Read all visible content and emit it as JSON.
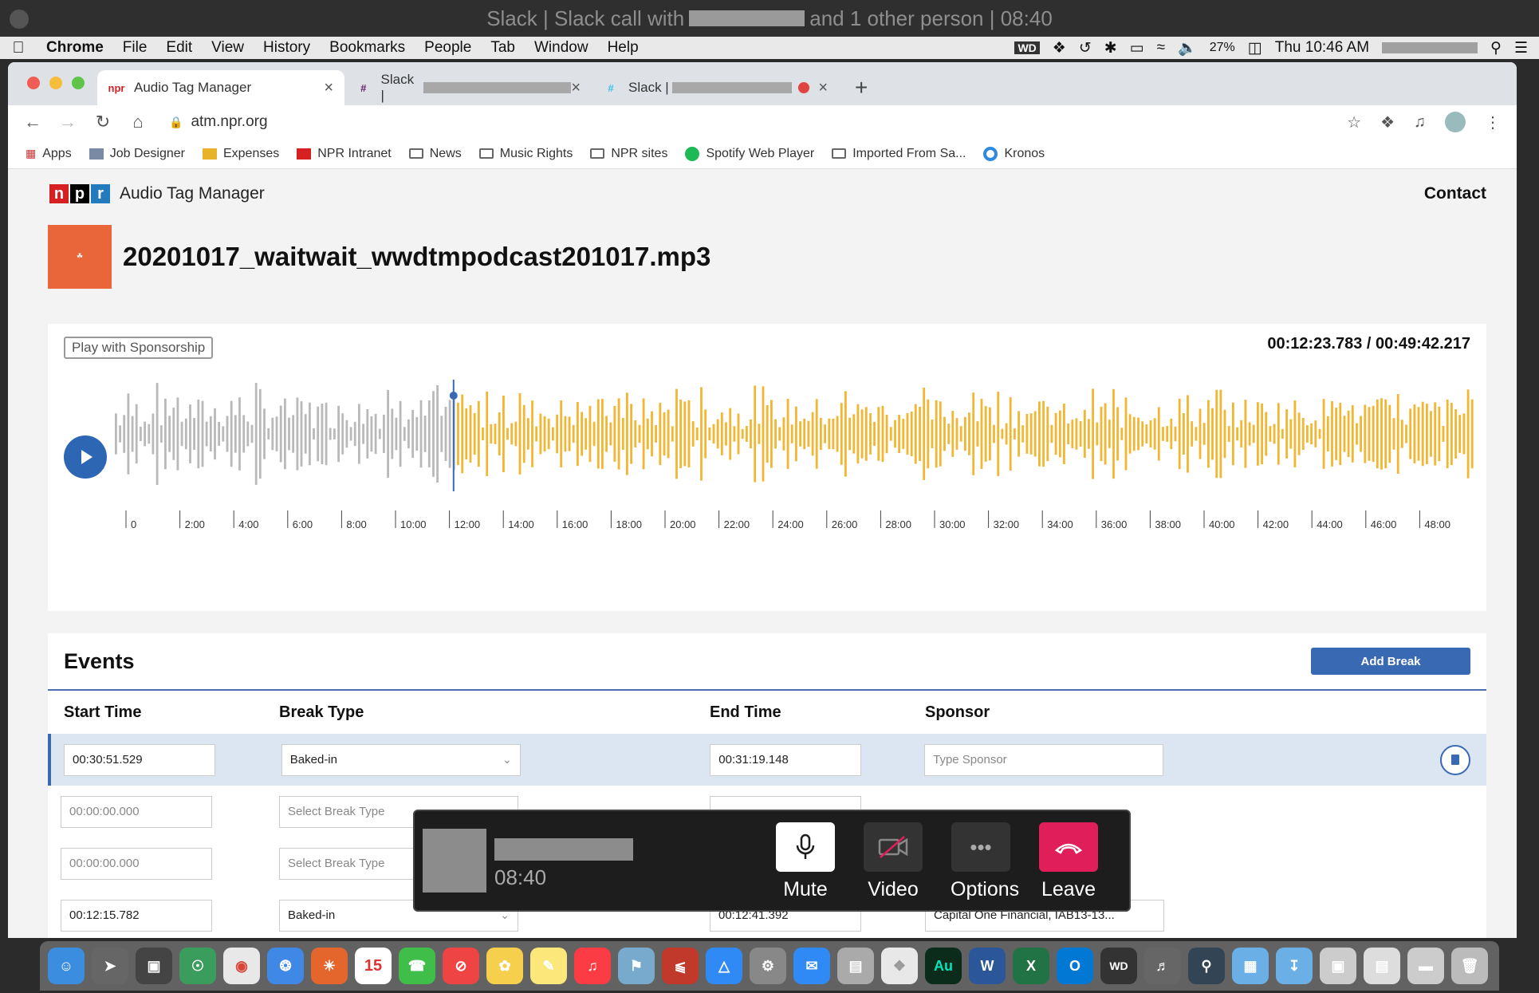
{
  "slack_window": {
    "title_left": "Slack | Slack call with",
    "title_right": "and 1 other person | 08:40"
  },
  "menubar": {
    "items": [
      "Chrome",
      "File",
      "Edit",
      "View",
      "History",
      "Bookmarks",
      "People",
      "Tab",
      "Window",
      "Help"
    ],
    "battery": "27%",
    "clock": "Thu 10:46 AM"
  },
  "browser": {
    "tabs": [
      {
        "title": "Audio Tag Manager"
      },
      {
        "title": "Slack |"
      },
      {
        "title": "Slack |"
      }
    ],
    "url": "atm.npr.org",
    "bookmarks": [
      "Apps",
      "Job Designer",
      "Expenses",
      "NPR Intranet",
      "News",
      "Music Rights",
      "NPR sites",
      "Spotify Web Player",
      "Imported From Sa...",
      "Kronos"
    ]
  },
  "app": {
    "logo_letters": [
      "n",
      "p",
      "r"
    ],
    "logo_colors": [
      "#d62021",
      "#000000",
      "#237bbd"
    ],
    "title": "Audio Tag Manager",
    "contact_label": "Contact",
    "filename": "20201017_waitwait_wwdtmpodcast201017.mp3"
  },
  "player": {
    "play_with_sponsorship_label": "Play with Sponsorship",
    "time_current": "00:12:23.783",
    "time_separator": " / ",
    "time_total": "00:49:42.217",
    "progress_fraction": 0.249,
    "played_color": "#b9b9b9",
    "unplayed_color": "#f2b632",
    "playhead_color": "#3a69b3",
    "timeline_labels": [
      "0",
      "2:00",
      "4:00",
      "6:00",
      "8:00",
      "10:00",
      "12:00",
      "14:00",
      "16:00",
      "18:00",
      "20:00",
      "22:00",
      "24:00",
      "26:00",
      "28:00",
      "30:00",
      "32:00",
      "34:00",
      "36:00",
      "38:00",
      "40:00",
      "42:00",
      "44:00",
      "46:00",
      "48:00"
    ]
  },
  "events": {
    "title": "Events",
    "add_break_label": "Add Break",
    "columns": {
      "start": "Start Time",
      "type": "Break Type",
      "end": "End Time",
      "sponsor": "Sponsor"
    },
    "sponsor_placeholder": "Type Sponsor",
    "rows": [
      {
        "start": "00:30:51.529",
        "type": "Baked-in",
        "end": "00:31:19.148",
        "sponsor": ""
      },
      {
        "start": "00:00:00.000",
        "type": "Select Break Type",
        "end": "",
        "sponsor": ""
      },
      {
        "start": "00:00:00.000",
        "type": "Select Break Type",
        "end": "",
        "sponsor": ""
      },
      {
        "start": "00:12:15.782",
        "type": "Baked-in",
        "end": "00:12:41.392",
        "sponsor": "Capital One Financial, IAB13-13..."
      }
    ]
  },
  "call": {
    "timer": "08:40",
    "mute_label": "Mute",
    "video_label": "Video",
    "options_label": "Options",
    "leave_label": "Leave",
    "leave_color": "#e01e5a"
  },
  "dock": {
    "calendar_day": "15",
    "app_labels": [
      "Au",
      "W",
      "X",
      "O"
    ]
  }
}
